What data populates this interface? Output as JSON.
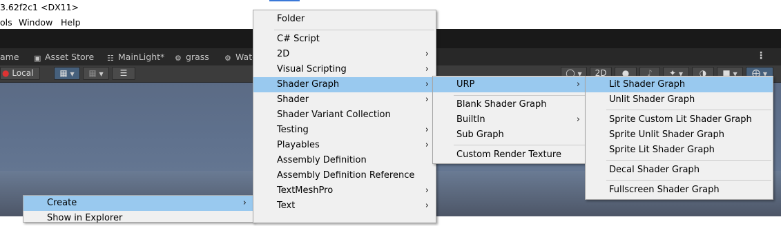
{
  "window": {
    "title": "3.62f2c1 <DX11>"
  },
  "menubar": {
    "items": [
      "ols",
      "Window",
      "Help"
    ]
  },
  "tabs": [
    {
      "label": "ame",
      "icon": "none"
    },
    {
      "label": "Asset Store",
      "icon": "shopping-bag-icon"
    },
    {
      "label": "MainLight*",
      "icon": "hierarchy-icon"
    },
    {
      "label": "grass",
      "icon": "padlock-icon"
    },
    {
      "label": "Wate",
      "icon": "padlock-icon"
    }
  ],
  "toolbar": {
    "pivot_label": "Local",
    "mode_2d": "2D"
  },
  "create_menu": {
    "items": [
      {
        "label": "Create",
        "submenu": true,
        "highlighted": true
      },
      {
        "label": "Show in Explorer",
        "submenu": false,
        "highlighted": false
      }
    ]
  },
  "create_submenu": {
    "items": [
      {
        "label": "Folder",
        "submenu": false
      },
      {
        "label": "C# Script",
        "submenu": false
      },
      {
        "label": "2D",
        "submenu": true
      },
      {
        "label": "Visual Scripting",
        "submenu": true
      },
      {
        "label": "Shader Graph",
        "submenu": true,
        "highlighted": true
      },
      {
        "label": "Shader",
        "submenu": true
      },
      {
        "label": "Shader Variant Collection",
        "submenu": false
      },
      {
        "label": "Testing",
        "submenu": true
      },
      {
        "label": "Playables",
        "submenu": true
      },
      {
        "label": "Assembly Definition",
        "submenu": false
      },
      {
        "label": "Assembly Definition Reference",
        "submenu": false
      },
      {
        "label": "TextMeshPro",
        "submenu": true
      },
      {
        "label": "Text",
        "submenu": true
      }
    ]
  },
  "shader_graph_submenu": {
    "items": [
      {
        "label": "URP",
        "submenu": true,
        "highlighted": true
      },
      {
        "label": "Blank Shader Graph",
        "submenu": false
      },
      {
        "label": "BuiltIn",
        "submenu": true
      },
      {
        "label": "Sub Graph",
        "submenu": false
      },
      {
        "label": "Custom Render Texture",
        "submenu": false
      }
    ]
  },
  "urp_submenu": {
    "items": [
      {
        "label": "Lit Shader Graph",
        "highlighted": true
      },
      {
        "label": "Unlit Shader Graph"
      },
      {
        "label": "Sprite Custom Lit Shader Graph"
      },
      {
        "label": "Sprite Unlit Shader Graph"
      },
      {
        "label": "Sprite Lit Shader Graph"
      },
      {
        "label": "Decal Shader Graph"
      },
      {
        "label": "Fullscreen Shader Graph"
      }
    ]
  },
  "colors": {
    "menu_bg": "#f0f0f0",
    "highlight": "#99c9ef",
    "editor_dark": "#282828"
  }
}
